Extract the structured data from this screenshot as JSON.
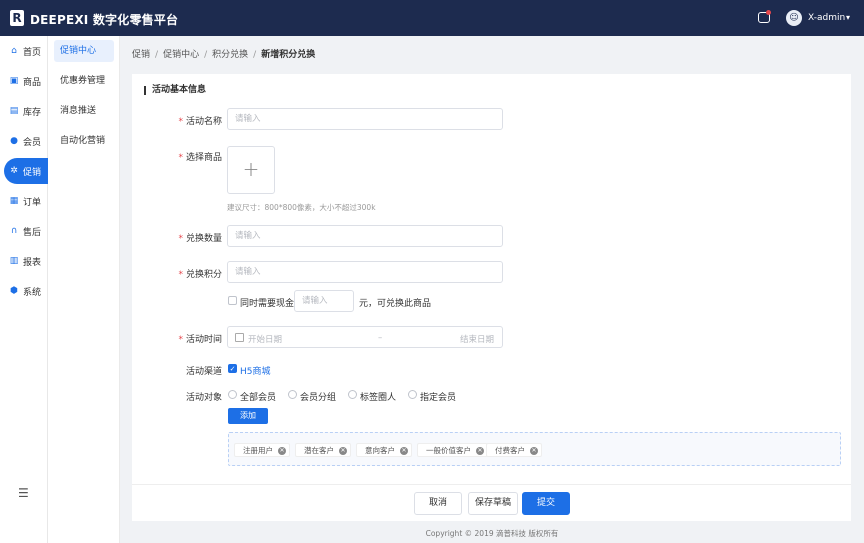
{
  "header": {
    "logo_letter": "R",
    "title": "DEEPEXI 数字化零售平台",
    "user": "X-admin",
    "avatar_glyph": "☺",
    "caret": "▾"
  },
  "sidebar": {
    "items": [
      {
        "label": "首页",
        "icon": "⌂"
      },
      {
        "label": "商品",
        "icon": "▣"
      },
      {
        "label": "库存",
        "icon": "▤"
      },
      {
        "label": "会员",
        "icon": "●"
      },
      {
        "label": "促销",
        "icon": "✲"
      },
      {
        "label": "订单",
        "icon": "▦"
      },
      {
        "label": "售后",
        "icon": "∩"
      },
      {
        "label": "报表",
        "icon": "▥"
      },
      {
        "label": "系统",
        "icon": "⬢"
      }
    ],
    "collapse_icon": "☰"
  },
  "subnav": {
    "items": [
      "促销中心",
      "优惠券管理",
      "消息推送",
      "自动化营销"
    ]
  },
  "breadcrumb": {
    "items": [
      "促销",
      "促销中心",
      "积分兑换"
    ],
    "current": "新增积分兑换",
    "separator": "/"
  },
  "form": {
    "section_title": "活动基本信息",
    "activity_name": {
      "label": "活动名称",
      "placeholder": "请输入"
    },
    "select_product": {
      "label": "选择商品",
      "upload_glyph": "+",
      "hint": "建议尺寸：800*800像素，大小不超过300k"
    },
    "exchange_qty": {
      "label": "兑换数量",
      "placeholder": "请输入"
    },
    "exchange_points": {
      "label": "兑换积分",
      "placeholder": "请输入"
    },
    "need_cash": {
      "label": "同时需要现金",
      "placeholder": "请输入",
      "suffix": "元，可兑换此商品"
    },
    "activity_time": {
      "label": "活动时间",
      "start": "开始日期",
      "dash": "–",
      "end": "结束日期"
    },
    "channel": {
      "label": "活动渠道",
      "option": "H5商城",
      "check": "✓"
    },
    "target": {
      "label": "活动对象",
      "options": [
        "全部会员",
        "会员分组",
        "标签圈人",
        "指定会员"
      ]
    },
    "add_button": "添加",
    "tags": [
      "注册用户",
      "潜在客户",
      "意向客户",
      "一般价值客户",
      "付费客户"
    ],
    "tag_close": "✕",
    "required_mark": "*"
  },
  "footer": {
    "cancel": "取消",
    "save_draft": "保存草稿",
    "submit": "提交",
    "copyright": "Copyright © 2019 滴普科技 版权所有"
  }
}
